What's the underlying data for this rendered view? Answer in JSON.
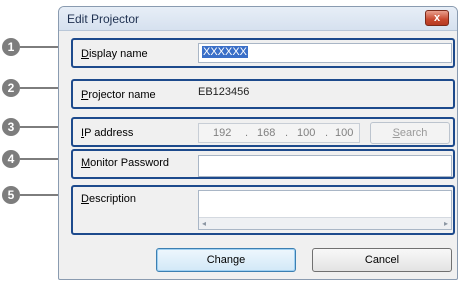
{
  "dialog": {
    "title": "Edit Projector",
    "close_symbol": "x"
  },
  "callouts": [
    "1",
    "2",
    "3",
    "4",
    "5"
  ],
  "fields": {
    "display_name": {
      "label_mnemonic": "D",
      "label_rest": "isplay name",
      "value": "XXXXXX"
    },
    "projector_name": {
      "label_mnemonic": "P",
      "label_rest": "rojector name",
      "value": "EB123456"
    },
    "ip_address": {
      "label_mnemonic": "I",
      "label_rest": "P address",
      "octets": [
        "192",
        "168",
        "100",
        "100"
      ],
      "separator": "."
    },
    "monitor_password": {
      "label_mnemonic": "M",
      "label_rest": "onitor Password",
      "value": ""
    },
    "description": {
      "label_mnemonic": "D",
      "label_rest": "escription",
      "value": ""
    }
  },
  "search": {
    "label_mnemonic": "S",
    "label_rest": "earch"
  },
  "scroll": {
    "left": "◂",
    "right": "▸"
  },
  "buttons": {
    "change": "Change",
    "cancel": "Cancel"
  }
}
